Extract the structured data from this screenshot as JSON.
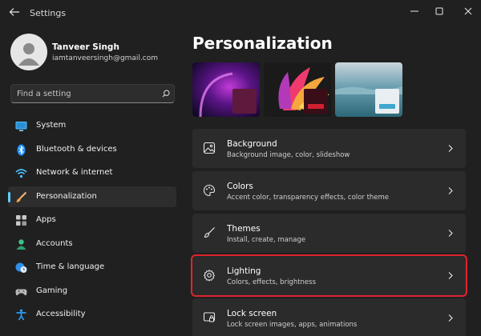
{
  "window": {
    "title": "Settings"
  },
  "user": {
    "name": "Tanveer Singh",
    "email": "iamtanveersingh@gmail.com"
  },
  "search": {
    "placeholder": "Find a setting"
  },
  "sidebar": {
    "items": [
      {
        "label": "System",
        "icon": "monitor-icon"
      },
      {
        "label": "Bluetooth & devices",
        "icon": "bluetooth-icon"
      },
      {
        "label": "Network & internet",
        "icon": "wifi-icon"
      },
      {
        "label": "Personalization",
        "icon": "paintbrush-icon",
        "active": true
      },
      {
        "label": "Apps",
        "icon": "apps-icon"
      },
      {
        "label": "Accounts",
        "icon": "person-icon"
      },
      {
        "label": "Time & language",
        "icon": "clock-globe-icon"
      },
      {
        "label": "Gaming",
        "icon": "gamepad-icon"
      },
      {
        "label": "Accessibility",
        "icon": "accessibility-icon"
      }
    ]
  },
  "main": {
    "title": "Personalization",
    "cards": [
      {
        "title": "Background",
        "subtitle": "Background image, color, slideshow",
        "icon": "image-icon"
      },
      {
        "title": "Colors",
        "subtitle": "Accent color, transparency effects, color theme",
        "icon": "palette-icon"
      },
      {
        "title": "Themes",
        "subtitle": "Install, create, manage",
        "icon": "brush-icon"
      },
      {
        "title": "Lighting",
        "subtitle": "Colors, effects, brightness",
        "icon": "gear-icon",
        "highlighted": true
      },
      {
        "title": "Lock screen",
        "subtitle": "Lock screen images, apps, animations",
        "icon": "lock-screen-icon"
      }
    ]
  },
  "colors": {
    "accent": "#60cdff",
    "highlight_border": "#e0242c",
    "background": "#202020",
    "card": "#2b2b2b"
  }
}
